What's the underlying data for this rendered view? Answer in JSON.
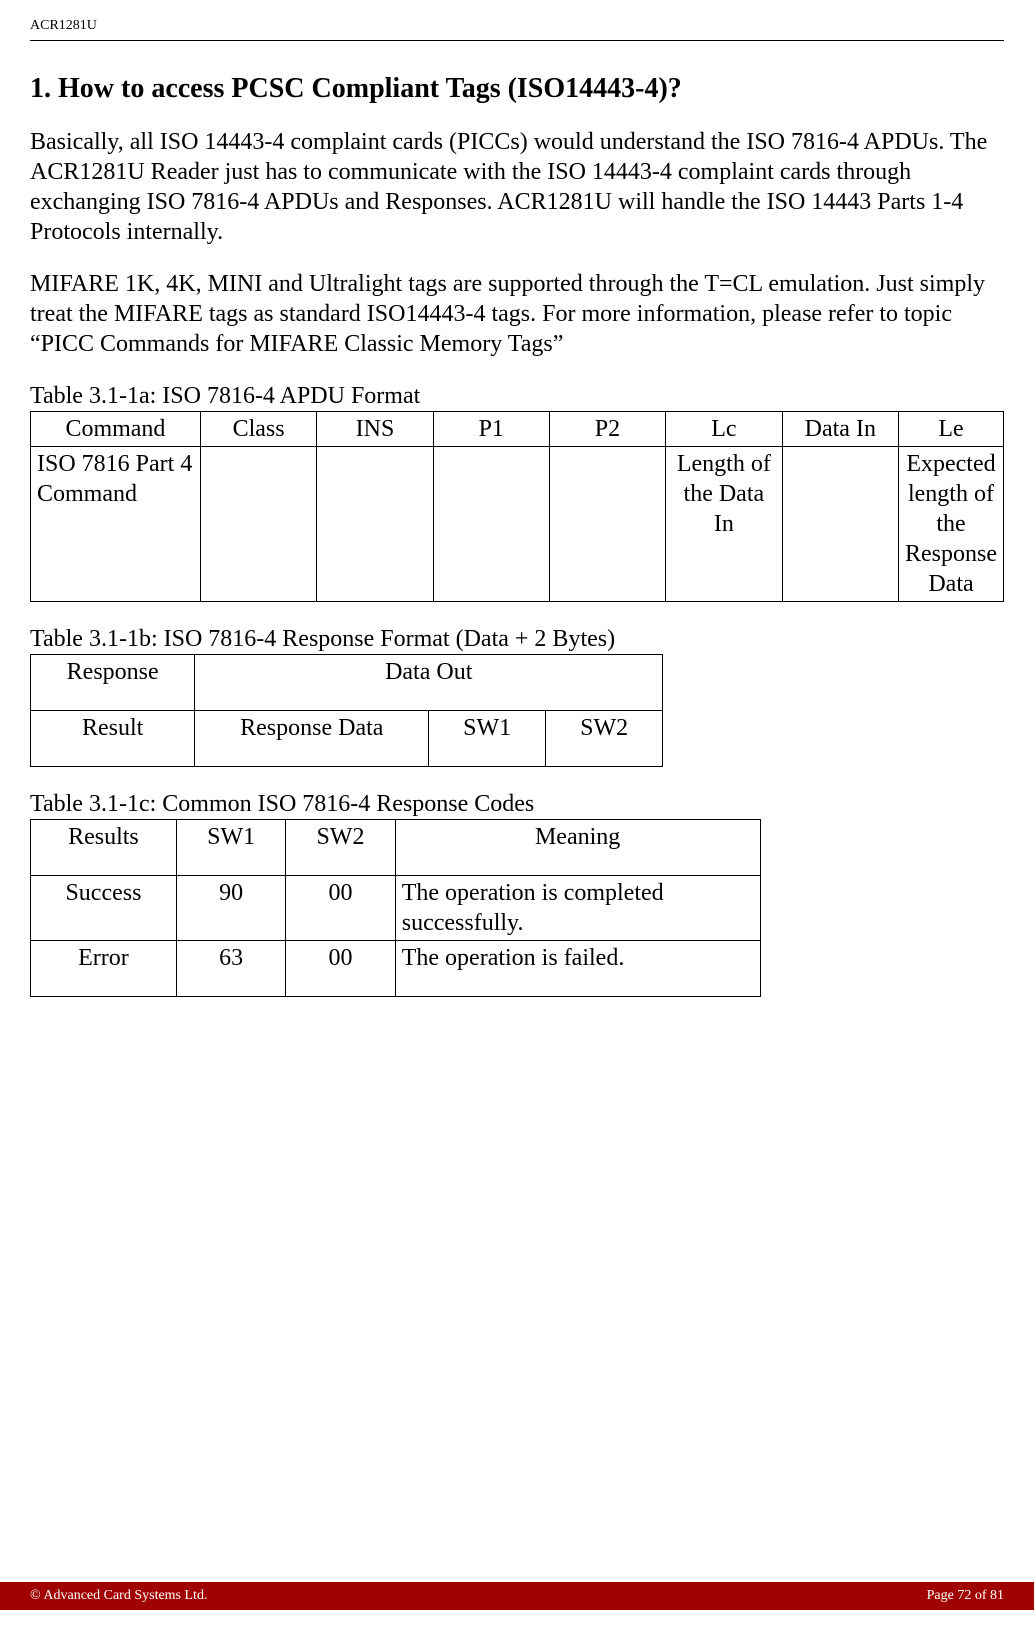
{
  "header": {
    "doc_id": "ACR1281U"
  },
  "section": {
    "title": "1. How to access PCSC Compliant Tags (ISO14443-4)?",
    "para1": "Basically, all ISO 14443-4 complaint cards (PICCs) would understand the ISO 7816-4 APDUs. The ACR1281U Reader just has to communicate with the ISO 14443-4 complaint cards through exchanging ISO 7816-4 APDUs and Responses. ACR1281U will handle the ISO 14443 Parts 1-4 Protocols internally.",
    "para2": "MIFARE 1K, 4K, MINI and Ultralight tags are supported through the T=CL emulation. Just simply treat the MIFARE tags as standard ISO14443-4 tags. For more information, please refer to topic “PICC Commands for MIFARE Classic Memory Tags”"
  },
  "table_a": {
    "caption": "Table 3.1-1a: ISO 7816-4 APDU Format",
    "headers": [
      "Command",
      "Class",
      "INS",
      "P1",
      "P2",
      "Lc",
      "Data In",
      "Le"
    ],
    "row": {
      "c0": "ISO 7816 Part 4 Command",
      "c1": "",
      "c2": "",
      "c3": "",
      "c4": "",
      "c5": "Length of the Data In",
      "c6": "",
      "c7": "Expected length of the Response Data"
    }
  },
  "table_b": {
    "caption": "Table 3.1-1b: ISO 7816-4 Response Format (Data + 2 Bytes)",
    "row1": {
      "c0": "Response",
      "c1": "Data Out"
    },
    "row2": {
      "c0": "Result",
      "c1": "Response Data",
      "c2": "SW1",
      "c3": "SW2"
    }
  },
  "table_c": {
    "caption": "Table 3.1-1c: Common ISO 7816-4 Response Codes",
    "headers": {
      "c0": "Results",
      "c1": "SW1",
      "c2": "SW2",
      "c3": "Meaning"
    },
    "rows": [
      {
        "c0": "Success",
        "c1": "90",
        "c2": "00",
        "c3": "The operation is completed successfully."
      },
      {
        "c0": "Error",
        "c1": "63",
        "c2": "00",
        "c3": "The operation is failed."
      }
    ]
  },
  "footer": {
    "left": "© Advanced Card Systems Ltd.",
    "right": "Page 72 of 81"
  }
}
